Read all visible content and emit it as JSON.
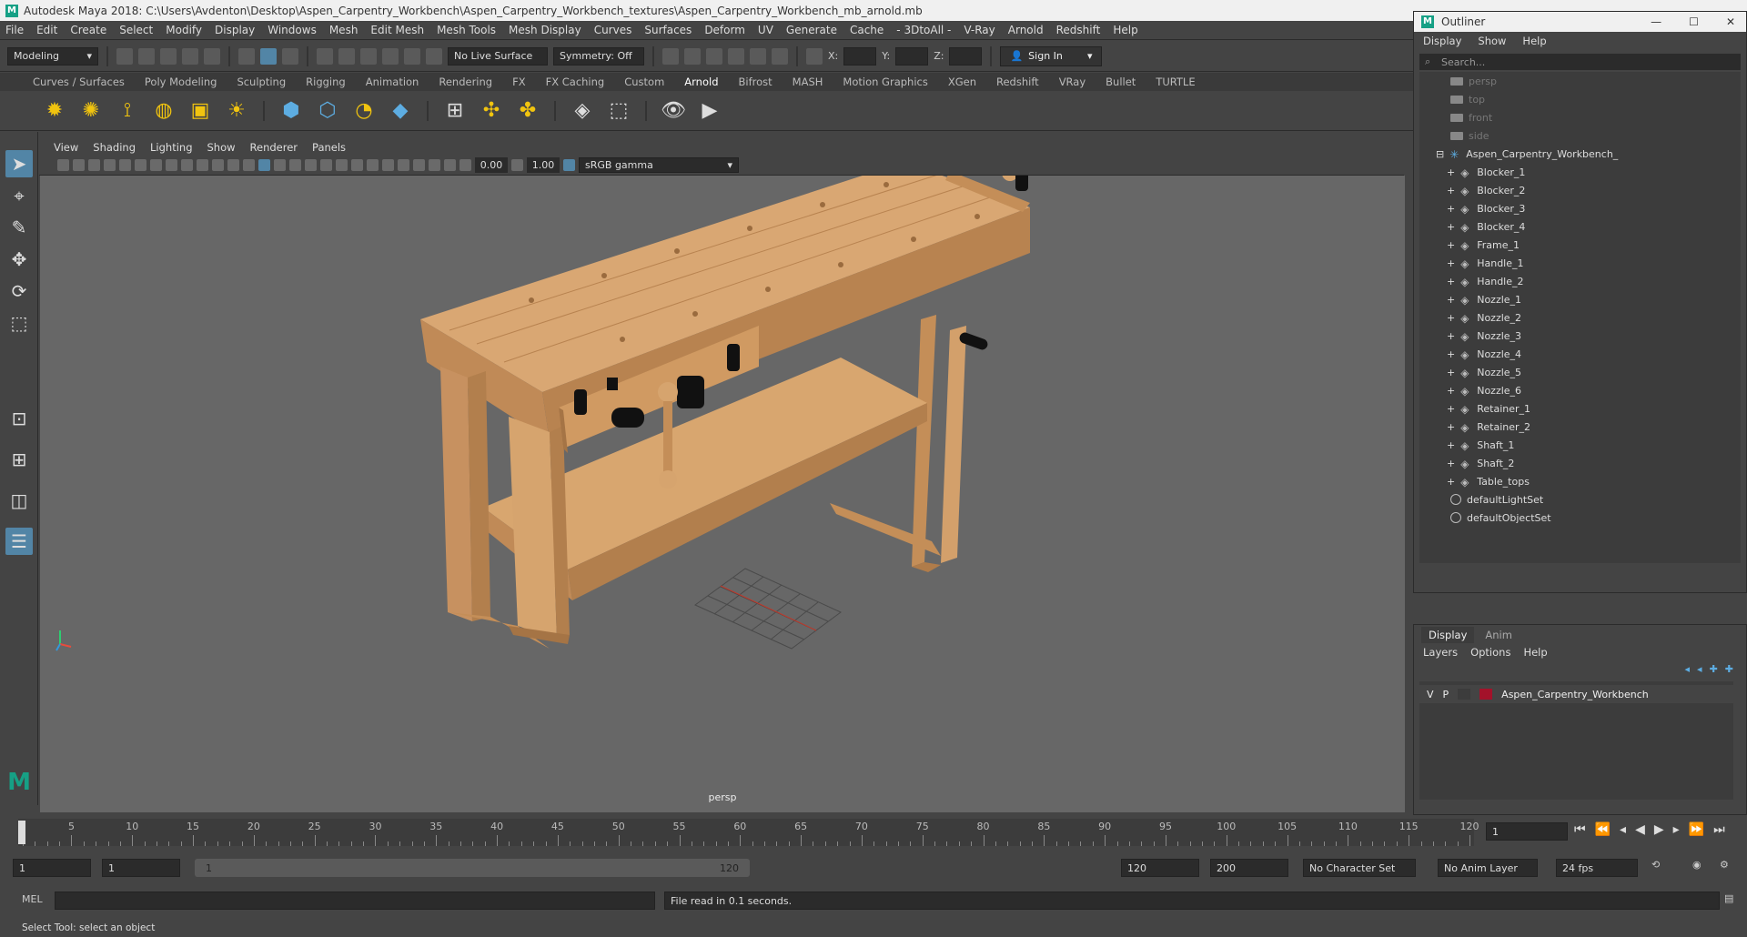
{
  "window": {
    "title": "Autodesk Maya 2018: C:\\Users\\Avdenton\\Desktop\\Aspen_Carpentry_Workbench\\Aspen_Carpentry_Workbench_textures\\Aspen_Carpentry_Workbench_mb_arnold.mb",
    "logo": "M"
  },
  "menubar": [
    "File",
    "Edit",
    "Create",
    "Select",
    "Modify",
    "Display",
    "Windows",
    "Mesh",
    "Edit Mesh",
    "Mesh Tools",
    "Mesh Display",
    "Curves",
    "Surfaces",
    "Deform",
    "UV",
    "Generate",
    "Cache",
    "- 3DtoAll -",
    "V-Ray",
    "Arnold",
    "Redshift",
    "Help"
  ],
  "statusline": {
    "menuset": "Modeling",
    "live_surface": "No Live Surface",
    "symmetry": "Symmetry: Off",
    "x_label": "X:",
    "y_label": "Y:",
    "z_label": "Z:",
    "sign_in": "Sign In"
  },
  "shelf_tabs": [
    "Curves / Surfaces",
    "Poly Modeling",
    "Sculpting",
    "Rigging",
    "Animation",
    "Rendering",
    "FX",
    "FX Caching",
    "Custom",
    "Arnold",
    "Bifrost",
    "MASH",
    "Motion Graphics",
    "XGen",
    "Redshift",
    "VRay",
    "Bullet",
    "TURTLE"
  ],
  "shelf_active": "Arnold",
  "viewport": {
    "menu": [
      "View",
      "Shading",
      "Lighting",
      "Show",
      "Renderer",
      "Panels"
    ],
    "exposure": "0.00",
    "gamma": "1.00",
    "color_space": "sRGB gamma",
    "camera_label": "persp"
  },
  "outliner": {
    "title": "Outliner",
    "menu": [
      "Display",
      "Show",
      "Help"
    ],
    "search_placeholder": "Search...",
    "cameras": [
      "persp",
      "top",
      "front",
      "side"
    ],
    "group": "Aspen_Carpentry_Workbench_",
    "children": [
      "Blocker_1",
      "Blocker_2",
      "Blocker_3",
      "Blocker_4",
      "Frame_1",
      "Handle_1",
      "Handle_2",
      "Nozzle_1",
      "Nozzle_2",
      "Nozzle_3",
      "Nozzle_4",
      "Nozzle_5",
      "Nozzle_6",
      "Retainer_1",
      "Retainer_2",
      "Shaft_1",
      "Shaft_2",
      "Table_tops"
    ],
    "sets": [
      "defaultLightSet",
      "defaultObjectSet"
    ]
  },
  "layer_editor": {
    "tabs": [
      "Display",
      "Anim"
    ],
    "menu": [
      "Layers",
      "Options",
      "Help"
    ],
    "layer": {
      "v": "V",
      "p": "P",
      "name": "Aspen_Carpentry_Workbench",
      "color": "#a3122a"
    }
  },
  "timeline": {
    "ticks": [
      "1",
      "5",
      "10",
      "15",
      "20",
      "25",
      "30",
      "35",
      "40",
      "45",
      "50",
      "55",
      "60",
      "65",
      "70",
      "75",
      "80",
      "85",
      "90",
      "95",
      "100",
      "105",
      "110",
      "115",
      "120"
    ],
    "current_frame": "1"
  },
  "range": {
    "start": "1",
    "playback_start": "1",
    "slider_start": "1",
    "slider_end": "120",
    "playback_end": "120",
    "end": "200",
    "character_set": "No Character Set",
    "anim_layer": "No Anim Layer",
    "fps": "24 fps"
  },
  "command": {
    "lang": "MEL",
    "result": "File read in  0.1 seconds."
  },
  "help_line": "Select Tool: select an object",
  "colors": {
    "accent": "#5285a6",
    "maya_teal": "#16a085",
    "wood": "#d09a62"
  }
}
